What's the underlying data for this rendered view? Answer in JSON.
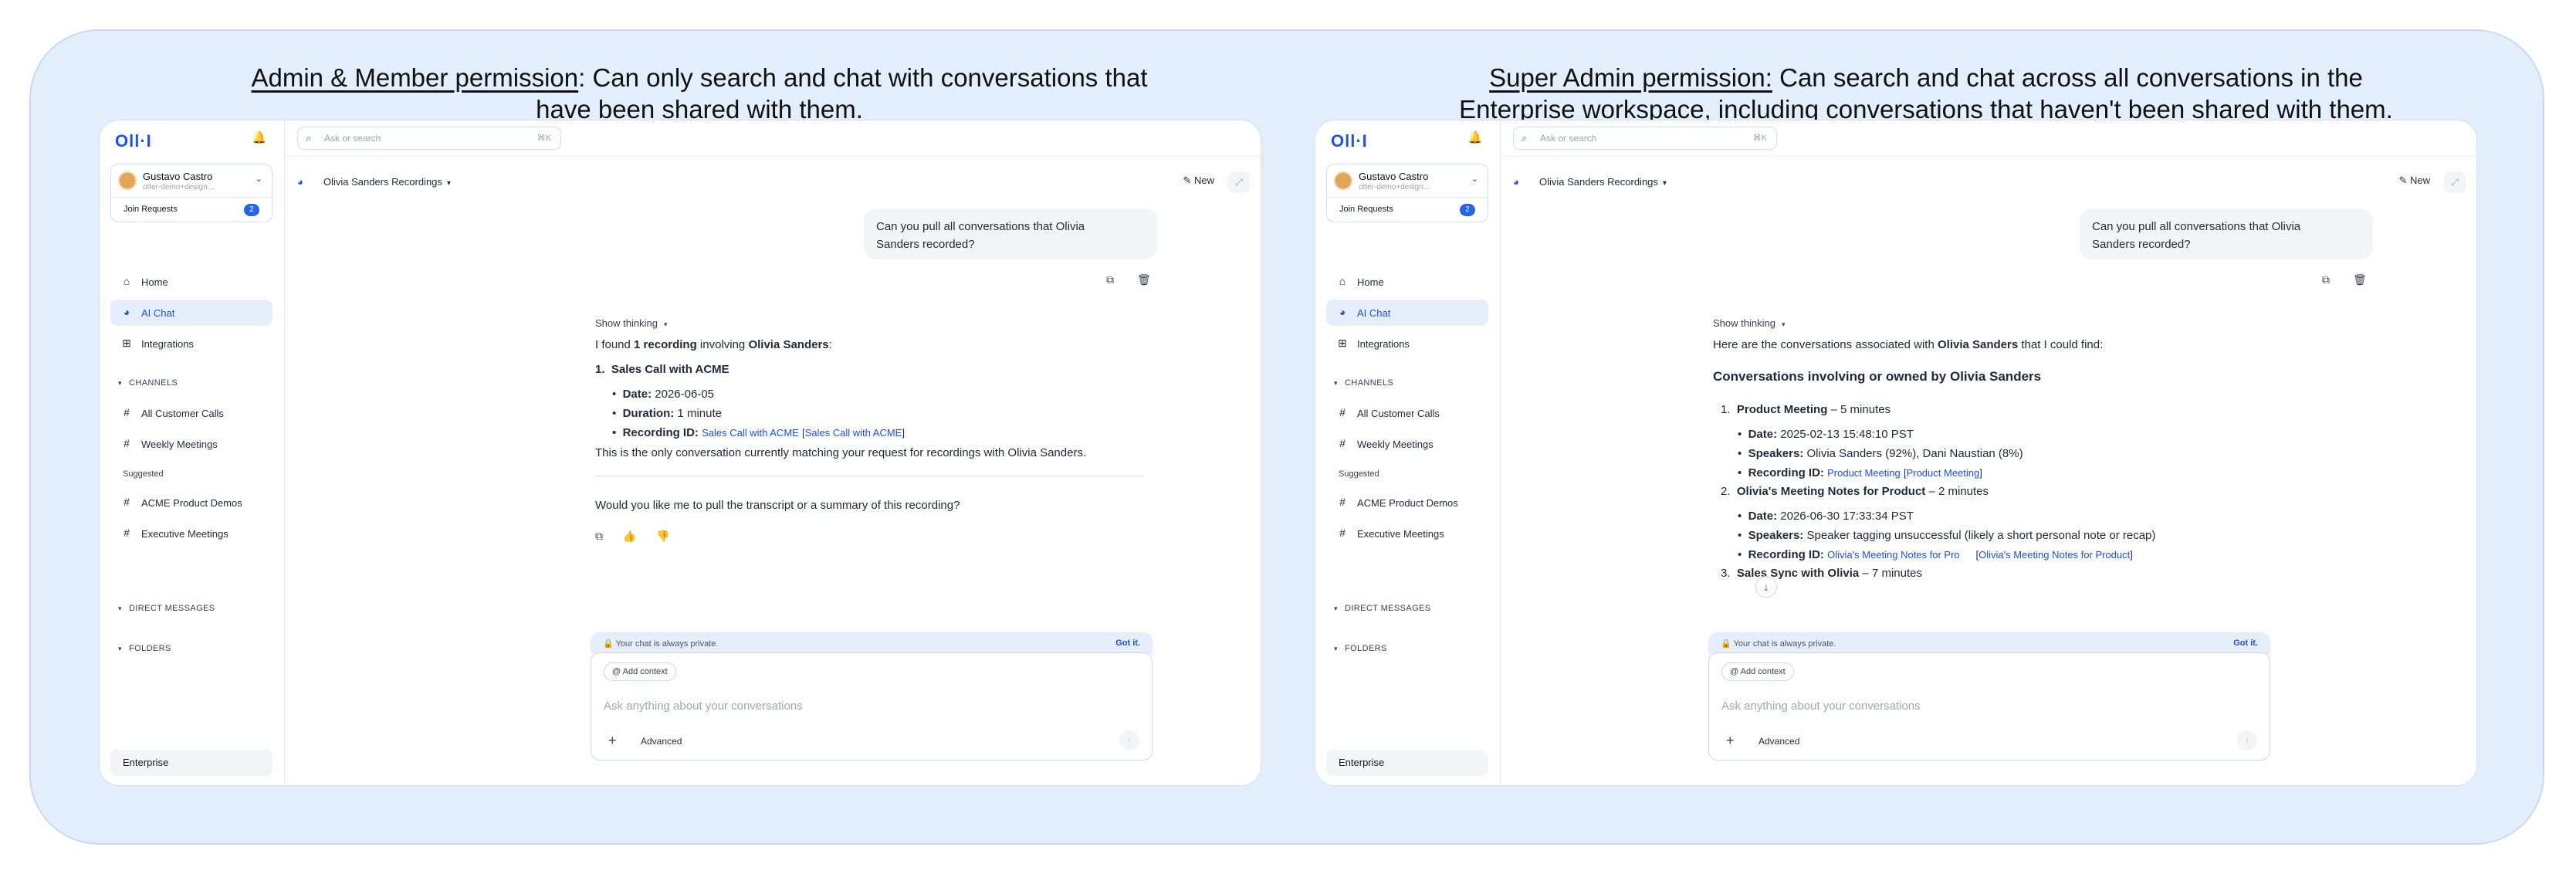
{
  "left_heading": {
    "underlined": "Admin & Member permission",
    "rest_line1": ": Can only search and chat with conversations that",
    "line2": "have been shared with them."
  },
  "right_heading": {
    "underlined": "Super Admin permission:",
    "rest_line1": " Can search and chat across all conversations in the",
    "line2": "Enterprise workspace, including conversations that haven't been shared with them."
  },
  "app": {
    "logo": "Oll·I",
    "user_name": "Gustavo Castro",
    "user_email": "otter-demo+design...",
    "join_requests": "Join Requests",
    "join_requests_count": "2",
    "nav": {
      "home": "Home",
      "ai_chat": "AI Chat",
      "integrations": "Integrations"
    },
    "channels_label": "CHANNELS",
    "channels": [
      "All Customer Calls",
      "Weekly Meetings"
    ],
    "suggested_label": "Suggested",
    "suggested": [
      "ACME Product Demos",
      "Executive Meetings"
    ],
    "direct_messages": "DIRECT MESSAGES",
    "folders": "FOLDERS",
    "enterprise": "Enterprise",
    "search_placeholder": "Ask or search",
    "search_shortcut": "⌘K",
    "chat_title": "Olivia Sanders Recordings",
    "new_label": "New",
    "user_question_l1": "Can you pull all conversations that Olivia",
    "user_question_l2": "Sanders recorded?",
    "show_thinking": "Show thinking",
    "private_note": "Your chat is always private.",
    "got_it": "Got it.",
    "add_context": "Add context",
    "ask_placeholder": "Ask anything about your conversations",
    "advanced": "Advanced"
  },
  "left_reply": {
    "p1_a": "I found ",
    "p1_b": "1 recording",
    "p1_c": " involving ",
    "p1_d": "Olivia Sanders",
    "p1_e": ":",
    "item_num": "1.",
    "item_title": "Sales Call with ACME",
    "date_label": "Date:",
    "date_value": " 2026-06-05",
    "dur_label": "Duration:",
    "dur_value": " 1 minute",
    "rec_label": "Recording ID:",
    "rec_link1": "Sales Call with ACME",
    "rec_link2": "Sales Call with ACME",
    "summary": "This is the only conversation currently matching your request for recordings with Olivia Sanders.",
    "followup": "Would you like me to pull the transcript or a summary of this recording?"
  },
  "right_reply": {
    "intro_a": "Here are the conversations associated with ",
    "intro_b": "Olivia Sanders",
    "intro_c": " that I could find:",
    "section_title": "Conversations involving or owned by Olivia Sanders",
    "items": [
      {
        "num": "1.",
        "title": "Product Meeting",
        "suffix": " – 5 minutes",
        "date": " 2025-02-13 15:48:10 PST",
        "speakers": " Olivia Sanders (92%), Dani Naustian (8%)",
        "link1": "Product Meeting",
        "link2": "Product Meeting"
      },
      {
        "num": "2.",
        "title": "Olivia's Meeting Notes for Product",
        "suffix": " – 2 minutes",
        "date": " 2026-06-30 17:33:34 PST",
        "speakers": " Speaker tagging unsuccessful (likely a short personal note or recap)",
        "link1": "Olivia's Meeting Notes for Pro",
        "link2": "Olivia's Meeting Notes for Product"
      },
      {
        "num": "3.",
        "title": "Sales Sync with Olivia",
        "suffix": " – 7 minutes"
      }
    ],
    "date_label": "Date:",
    "speakers_label": "Speakers:",
    "rec_label": "Recording ID:"
  },
  "colors": {
    "accent": "#1d4ed8",
    "frame_bg": "#e3eefc",
    "bubble_bg": "#f3f4f6"
  }
}
